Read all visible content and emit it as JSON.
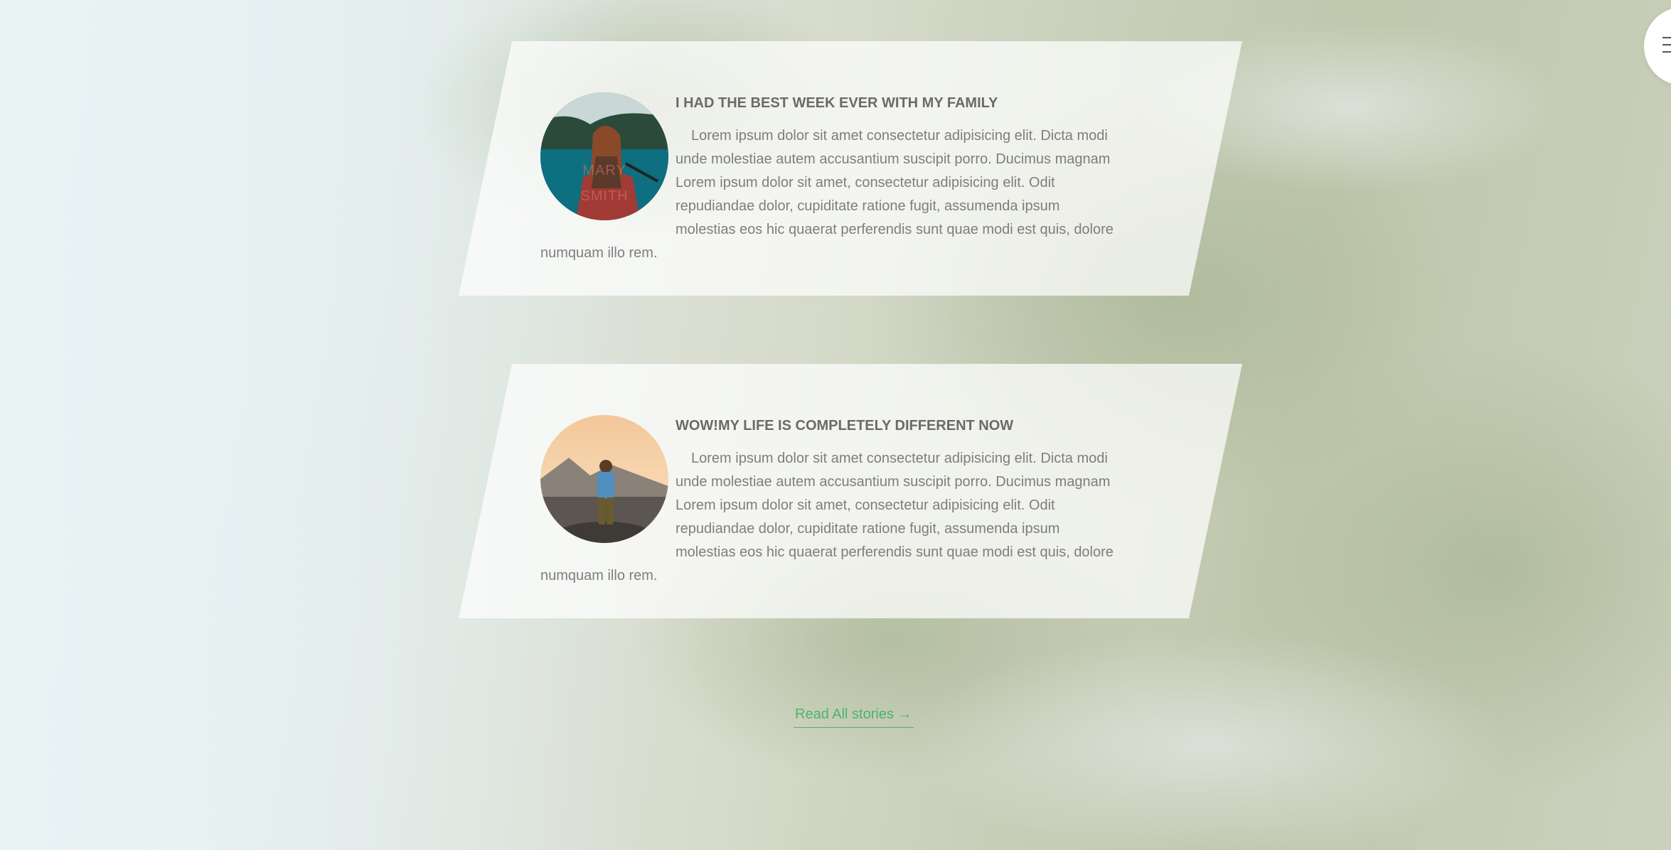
{
  "menu": {
    "icon": "hamburger-icon"
  },
  "testimonials": [
    {
      "title": "I HAD THE BEST WEEK EVER WITH MY FAMILY",
      "avatar_caption_line1": "MARY",
      "avatar_caption_line2": "SMITH",
      "body": "Lorem ipsum dolor sit amet consectetur adipisicing elit. Dicta modi unde molestiae autem accusantium suscipit porro. Ducimus magnam Lorem ipsum dolor sit amet, consectetur adipisicing elit. Odit repudiandae dolor, cupiditate ratione fugit, assumenda ipsum molestias eos hic quaerat perferendis sunt quae modi est quis, dolore numquam illo rem."
    },
    {
      "title": "WOW!MY LIFE IS COMPLETELY DIFFERENT NOW",
      "body": "Lorem ipsum dolor sit amet consectetur adipisicing elit. Dicta modi unde molestiae autem accusantium suscipit porro. Ducimus magnam Lorem ipsum dolor sit amet, consectetur adipisicing elit. Odit repudiandae dolor, cupiditate ratione fugit, assumenda ipsum molestias eos hic quaerat perferendis sunt quae modi est quis, dolore numquam illo rem."
    }
  ],
  "cta": {
    "label": "Read All stories →",
    "color": "#4cb469"
  }
}
